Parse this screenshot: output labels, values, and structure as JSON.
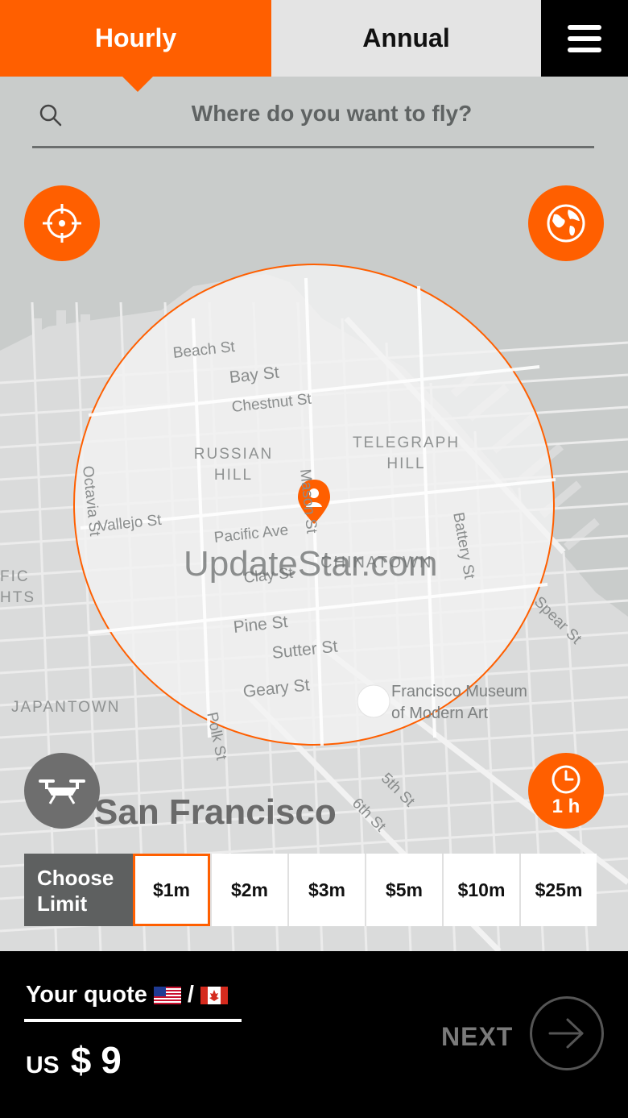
{
  "tabs": {
    "hourly": "Hourly",
    "annual": "Annual",
    "active": "hourly"
  },
  "search": {
    "placeholder": "Where do you want to fly?"
  },
  "map": {
    "streets": [
      "Beach St",
      "Bay St",
      "Chestnut St",
      "Vallejo St",
      "Pacific Ave",
      "Clay St",
      "Pine St",
      "Sutter St",
      "Geary St",
      "Octavia St",
      "Mason St",
      "Battery St",
      "Spear St",
      "Polk St",
      "5th St",
      "6th St"
    ],
    "districts": [
      "RUSSIAN HILL",
      "TELEGRAPH HILL",
      "CHINATOWN",
      "JAPANTOWN",
      "FIC",
      "HTS"
    ],
    "poi": "Francisco Museum of Modern Art",
    "city": "San Francisco",
    "watermark": "UpdateStar.com",
    "accent_color": "#FF5F00"
  },
  "buttons": {
    "locate_icon": "crosshair-icon",
    "globe_icon": "globe-icon",
    "drone_icon": "drone-icon",
    "duration": "1 h"
  },
  "limits": {
    "label": "Choose Limit",
    "options": [
      "$1m",
      "$2m",
      "$3m",
      "$5m",
      "$10m",
      "$25m"
    ],
    "selected": "$1m"
  },
  "quote": {
    "title": "Your quote",
    "separator": "/",
    "currency": "US",
    "symbol": "$",
    "amount": "9"
  },
  "next": {
    "label": "NEXT"
  }
}
